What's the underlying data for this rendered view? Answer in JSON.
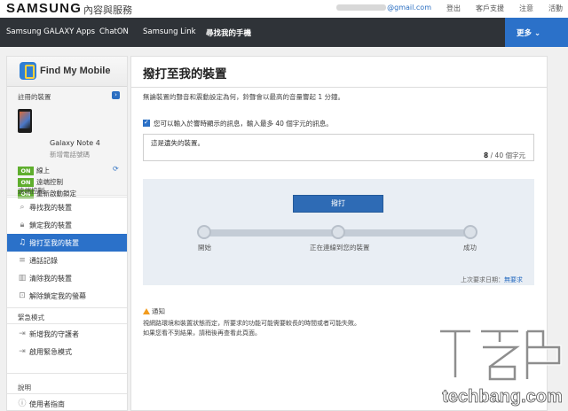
{
  "header": {
    "logo": "SAMSUNG",
    "site_name": "內容與服務",
    "email_suffix": "@gmail.com",
    "links": [
      "登出",
      "客戶支援",
      "注意",
      "活動"
    ]
  },
  "nav": {
    "items": [
      "Samsung GALAXY Apps",
      "ChatON",
      "Samsung Link",
      "尋找我的手機"
    ],
    "more": "更多 ⌄",
    "active_color": "#2b71c9"
  },
  "sidebar": {
    "app_title": "Find My Mobile",
    "registered_label": "註冊的裝置",
    "device_name": "Galaxy Note 4",
    "device_sub": "新增電話號碼",
    "statuses": [
      {
        "badge": "ON",
        "label": "線上"
      },
      {
        "badge": "ON",
        "label": "遠端控制"
      },
      {
        "badge": "ON",
        "label": "重新啟動鎖定"
      }
    ],
    "remote_label": "遠端控制",
    "remote_items": [
      {
        "icon": "search-icon",
        "label": "尋找我的裝置"
      },
      {
        "icon": "lock-icon",
        "label": "鎖定我的裝置"
      },
      {
        "icon": "music-note-icon",
        "label": "撥打至我的裝置"
      },
      {
        "icon": "list-icon",
        "label": "通話記錄"
      },
      {
        "icon": "trash-icon",
        "label": "清除我的裝置"
      },
      {
        "icon": "unlock-icon",
        "label": "解除鎖定我的螢幕"
      }
    ],
    "emergency_label": "緊急模式",
    "emergency_items": [
      {
        "icon": "login-icon",
        "label": "新增我的守護者"
      },
      {
        "icon": "login-icon",
        "label": "啟用緊急模式"
      }
    ],
    "help_label": "說明",
    "help_items": [
      {
        "icon": "info-icon",
        "label": "使用者指南"
      }
    ]
  },
  "main": {
    "title": "撥打至我的裝置",
    "description": "無論裝置的聲音和震動設定為何，鈴聲會以最高的音量響起 1 分鐘。",
    "checkbox_label": "您可以輸入於響時顯示的訊息，輸入最多 40 個字元的訊息。",
    "message": "這是遺失的裝置。",
    "counter_current": "8",
    "counter_rest": " / 40 個字元",
    "ring_button": "撥打",
    "stages": [
      "開始",
      "正在連線到您的裝置",
      "成功"
    ],
    "last_request_label": "上次要求日期：",
    "last_request_value": "無要求",
    "notice_title": "通知",
    "notice_line1": "視網路環境和裝置狀態而定，所要求的功能可能需要較長的時間或者可能失敗。",
    "notice_line2": "如果您看不到結果，請稍後再查看此頁面。"
  },
  "watermark": {
    "brand_cn": "T客邦",
    "brand_en": "techbang.com"
  }
}
